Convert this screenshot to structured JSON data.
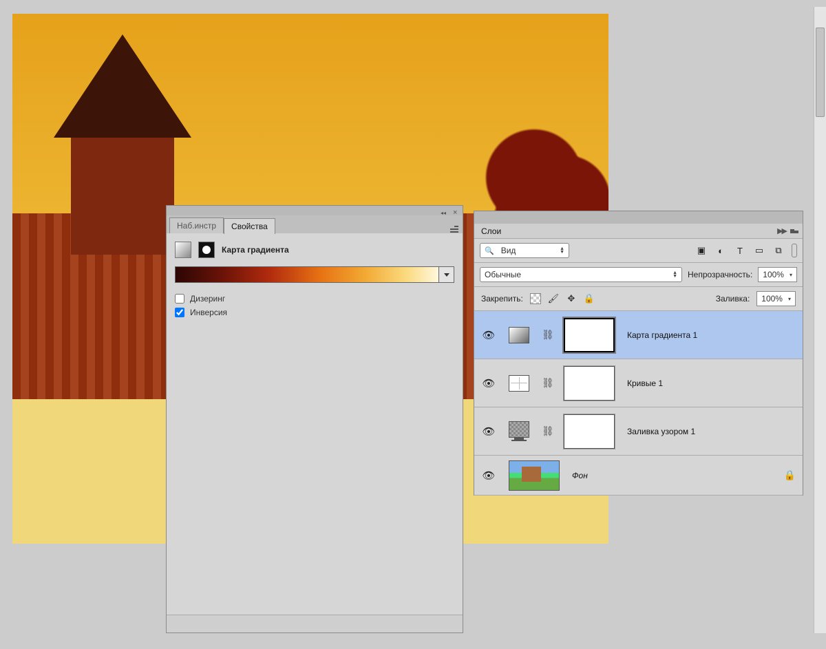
{
  "properties_panel": {
    "tabs": {
      "presets": "Наб.инстр",
      "properties": "Свойства"
    },
    "title": "Карта градиента",
    "dither_label": "Дизеринг",
    "reverse_label": "Инверсия",
    "dither_checked": false,
    "reverse_checked": true
  },
  "layers_panel": {
    "title": "Слои",
    "filter_kind": "Вид",
    "blend_mode": "Обычные",
    "opacity_label": "Непрозрачность:",
    "opacity_value": "100%",
    "lock_label": "Закрепить:",
    "fill_label": "Заливка:",
    "fill_value": "100%",
    "layers": [
      {
        "name": "Карта градиента 1",
        "type": "gradient-map",
        "selected": true
      },
      {
        "name": "Кривые 1",
        "type": "curves",
        "selected": false
      },
      {
        "name": "Заливка узором 1",
        "type": "pattern",
        "selected": false
      },
      {
        "name": "Фон",
        "type": "background",
        "selected": false
      }
    ]
  }
}
